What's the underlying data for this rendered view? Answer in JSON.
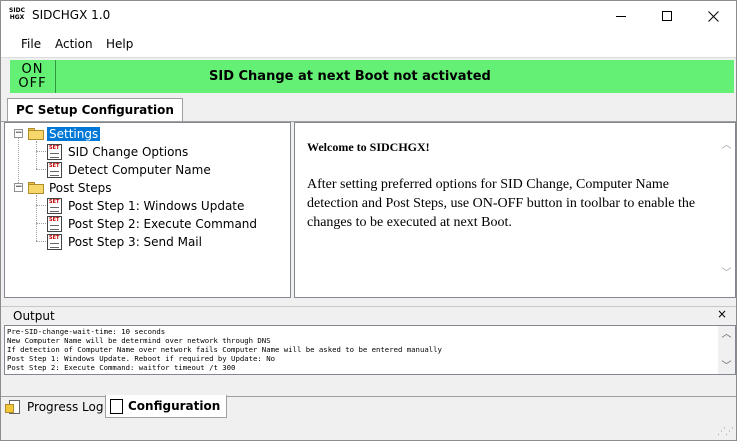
{
  "window": {
    "title": "SIDCHGX 1.0",
    "icon_text": "SIDCHGX"
  },
  "menu": {
    "items": [
      "File",
      "Action",
      "Help"
    ]
  },
  "toolbar": {
    "onoff_on": "ON",
    "onoff_off": "OFF",
    "status_text": "SID Change at next Boot not activated",
    "status_color": "#63f075"
  },
  "tabs": {
    "top": "PC Setup Configuration"
  },
  "tree": {
    "settings": {
      "label": "Settings",
      "expander": "−",
      "children": [
        "SID Change Options",
        "Detect Computer Name"
      ]
    },
    "post_steps": {
      "label": "Post Steps",
      "expander": "−",
      "children": [
        "Post Step 1: Windows Update",
        "Post Step 2: Execute Command",
        "Post Step 3: Send Mail"
      ]
    },
    "item_icon_tag": "SET"
  },
  "welcome": {
    "title": "Welcome to SIDCHGX!",
    "body": "After setting preferred options for SID Change, Computer Name detection and Post Steps, use ON-OFF button in toolbar to enable the changes to be executed at next Boot."
  },
  "output": {
    "title": "Output",
    "close_label": "×",
    "lines": [
      "Pre-SID-change-wait-time: 10 seconds",
      "New Computer Name will be determind over network through DNS",
      "If detection of Computer Name over network fails Computer Name will be asked to be entered manually",
      "Post Step 1: Windows Update. Reboot if required by Update: No",
      "Post Step 2: Execute Command: waitfor timeout /t 300"
    ]
  },
  "bottom_tabs": {
    "progress": "Progress Log",
    "configuration": "Configuration"
  },
  "colors": {
    "selection": "#0078d7",
    "accent_green": "#63f075"
  }
}
